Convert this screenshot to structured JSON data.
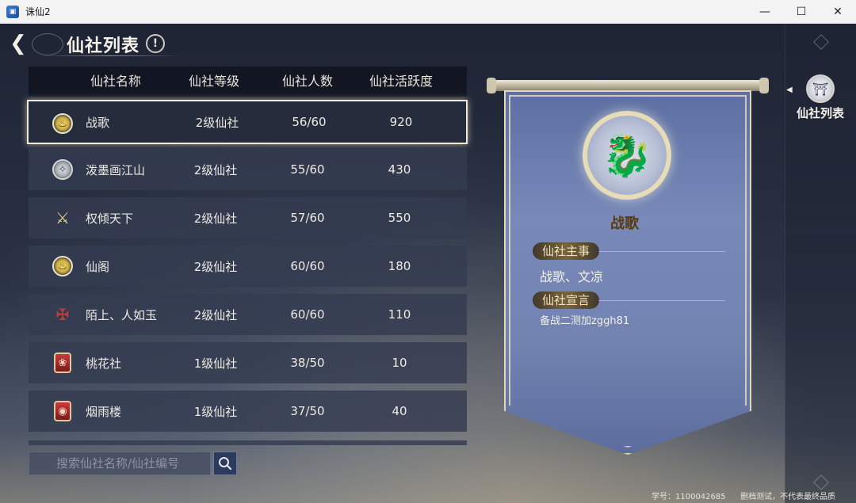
{
  "window": {
    "title": "诛仙2",
    "icon_name": "app-icon"
  },
  "header": {
    "title": "仙社列表",
    "info_glyph": "!"
  },
  "table": {
    "columns": [
      "仙社名称",
      "仙社等级",
      "仙社人数",
      "仙社活跃度"
    ],
    "rows": [
      {
        "name": "战歌",
        "level": "2级仙社",
        "members": "56/60",
        "activity": "920",
        "emblem": "gold-dragon-emblem",
        "selected": true
      },
      {
        "name": "泼墨画江山",
        "level": "2级仙社",
        "members": "55/60",
        "activity": "430",
        "emblem": "wing-emblem",
        "selected": false
      },
      {
        "name": "权倾天下",
        "level": "2级仙社",
        "members": "57/60",
        "activity": "550",
        "emblem": "crossed-swords-emblem",
        "selected": false
      },
      {
        "name": "仙阁",
        "level": "2级仙社",
        "members": "60/60",
        "activity": "180",
        "emblem": "gold-flame-emblem",
        "selected": false
      },
      {
        "name": "陌上、人如玉",
        "level": "2级仙社",
        "members": "60/60",
        "activity": "110",
        "emblem": "red-crossed-emblem",
        "selected": false
      },
      {
        "name": "桃花社",
        "level": "1级仙社",
        "members": "38/50",
        "activity": "10",
        "emblem": "red-shield-emblem",
        "selected": false
      },
      {
        "name": "烟雨楼",
        "level": "1级仙社",
        "members": "37/50",
        "activity": "40",
        "emblem": "red-scroll-emblem",
        "selected": false
      }
    ]
  },
  "search": {
    "placeholder": "搜索仙社名称/仙社编号"
  },
  "detail": {
    "guild_name": "战歌",
    "leader_label": "仙社主事",
    "leader_value": "战歌、文凉",
    "declaration_label": "仙社宣言",
    "declaration_value": "备战二测加zggh81"
  },
  "side_nav": {
    "active_tab": "仙社列表"
  },
  "footer": {
    "id_text": "学号：1100042685",
    "note_text": "删档测试，不代表最终品质"
  },
  "colors": {
    "selected_border": "#efe8d2",
    "banner": "#7283b2",
    "emblem_gold": "#d8bb2a"
  }
}
